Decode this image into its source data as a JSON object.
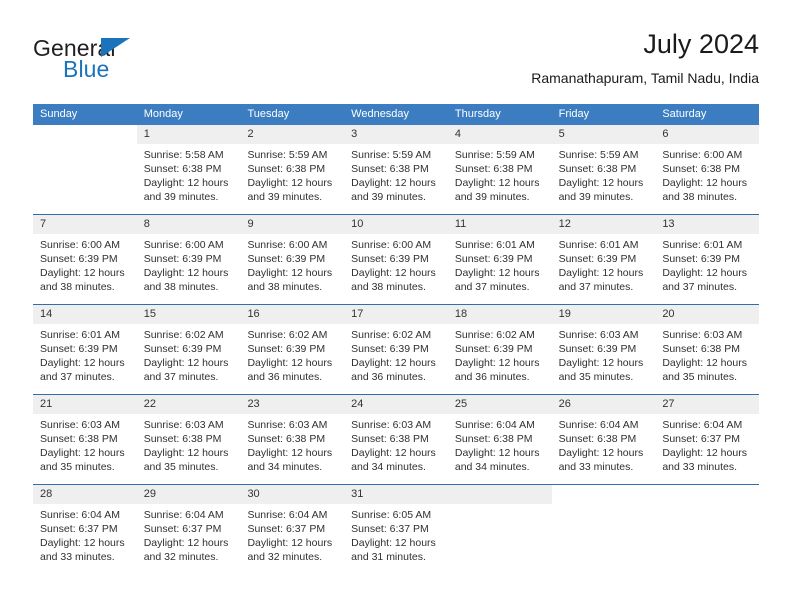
{
  "brand": {
    "name_top": "General",
    "name_bottom": "Blue",
    "triangle_color": "#1b74bb",
    "text_color": "#231f20"
  },
  "header": {
    "title": "July 2024",
    "location": "Ramanathapuram, Tamil Nadu, India"
  },
  "theme": {
    "header_bar_color": "#3b7dc0",
    "header_text_color": "#ffffff",
    "day_number_band": "#efefef",
    "week_rule_color": "#2f6fae"
  },
  "weekdays": [
    "Sunday",
    "Monday",
    "Tuesday",
    "Wednesday",
    "Thursday",
    "Friday",
    "Saturday"
  ],
  "weeks": [
    [
      {
        "day": "",
        "sunrise": "",
        "sunset": "",
        "daylight1": "",
        "daylight2": "",
        "blank": true
      },
      {
        "day": "1",
        "sunrise": "Sunrise: 5:58 AM",
        "sunset": "Sunset: 6:38 PM",
        "daylight1": "Daylight: 12 hours",
        "daylight2": "and 39 minutes."
      },
      {
        "day": "2",
        "sunrise": "Sunrise: 5:59 AM",
        "sunset": "Sunset: 6:38 PM",
        "daylight1": "Daylight: 12 hours",
        "daylight2": "and 39 minutes."
      },
      {
        "day": "3",
        "sunrise": "Sunrise: 5:59 AM",
        "sunset": "Sunset: 6:38 PM",
        "daylight1": "Daylight: 12 hours",
        "daylight2": "and 39 minutes."
      },
      {
        "day": "4",
        "sunrise": "Sunrise: 5:59 AM",
        "sunset": "Sunset: 6:38 PM",
        "daylight1": "Daylight: 12 hours",
        "daylight2": "and 39 minutes."
      },
      {
        "day": "5",
        "sunrise": "Sunrise: 5:59 AM",
        "sunset": "Sunset: 6:38 PM",
        "daylight1": "Daylight: 12 hours",
        "daylight2": "and 39 minutes."
      },
      {
        "day": "6",
        "sunrise": "Sunrise: 6:00 AM",
        "sunset": "Sunset: 6:38 PM",
        "daylight1": "Daylight: 12 hours",
        "daylight2": "and 38 minutes."
      }
    ],
    [
      {
        "day": "7",
        "sunrise": "Sunrise: 6:00 AM",
        "sunset": "Sunset: 6:39 PM",
        "daylight1": "Daylight: 12 hours",
        "daylight2": "and 38 minutes."
      },
      {
        "day": "8",
        "sunrise": "Sunrise: 6:00 AM",
        "sunset": "Sunset: 6:39 PM",
        "daylight1": "Daylight: 12 hours",
        "daylight2": "and 38 minutes."
      },
      {
        "day": "9",
        "sunrise": "Sunrise: 6:00 AM",
        "sunset": "Sunset: 6:39 PM",
        "daylight1": "Daylight: 12 hours",
        "daylight2": "and 38 minutes."
      },
      {
        "day": "10",
        "sunrise": "Sunrise: 6:00 AM",
        "sunset": "Sunset: 6:39 PM",
        "daylight1": "Daylight: 12 hours",
        "daylight2": "and 38 minutes."
      },
      {
        "day": "11",
        "sunrise": "Sunrise: 6:01 AM",
        "sunset": "Sunset: 6:39 PM",
        "daylight1": "Daylight: 12 hours",
        "daylight2": "and 37 minutes."
      },
      {
        "day": "12",
        "sunrise": "Sunrise: 6:01 AM",
        "sunset": "Sunset: 6:39 PM",
        "daylight1": "Daylight: 12 hours",
        "daylight2": "and 37 minutes."
      },
      {
        "day": "13",
        "sunrise": "Sunrise: 6:01 AM",
        "sunset": "Sunset: 6:39 PM",
        "daylight1": "Daylight: 12 hours",
        "daylight2": "and 37 minutes."
      }
    ],
    [
      {
        "day": "14",
        "sunrise": "Sunrise: 6:01 AM",
        "sunset": "Sunset: 6:39 PM",
        "daylight1": "Daylight: 12 hours",
        "daylight2": "and 37 minutes."
      },
      {
        "day": "15",
        "sunrise": "Sunrise: 6:02 AM",
        "sunset": "Sunset: 6:39 PM",
        "daylight1": "Daylight: 12 hours",
        "daylight2": "and 37 minutes."
      },
      {
        "day": "16",
        "sunrise": "Sunrise: 6:02 AM",
        "sunset": "Sunset: 6:39 PM",
        "daylight1": "Daylight: 12 hours",
        "daylight2": "and 36 minutes."
      },
      {
        "day": "17",
        "sunrise": "Sunrise: 6:02 AM",
        "sunset": "Sunset: 6:39 PM",
        "daylight1": "Daylight: 12 hours",
        "daylight2": "and 36 minutes."
      },
      {
        "day": "18",
        "sunrise": "Sunrise: 6:02 AM",
        "sunset": "Sunset: 6:39 PM",
        "daylight1": "Daylight: 12 hours",
        "daylight2": "and 36 minutes."
      },
      {
        "day": "19",
        "sunrise": "Sunrise: 6:03 AM",
        "sunset": "Sunset: 6:39 PM",
        "daylight1": "Daylight: 12 hours",
        "daylight2": "and 35 minutes."
      },
      {
        "day": "20",
        "sunrise": "Sunrise: 6:03 AM",
        "sunset": "Sunset: 6:38 PM",
        "daylight1": "Daylight: 12 hours",
        "daylight2": "and 35 minutes."
      }
    ],
    [
      {
        "day": "21",
        "sunrise": "Sunrise: 6:03 AM",
        "sunset": "Sunset: 6:38 PM",
        "daylight1": "Daylight: 12 hours",
        "daylight2": "and 35 minutes."
      },
      {
        "day": "22",
        "sunrise": "Sunrise: 6:03 AM",
        "sunset": "Sunset: 6:38 PM",
        "daylight1": "Daylight: 12 hours",
        "daylight2": "and 35 minutes."
      },
      {
        "day": "23",
        "sunrise": "Sunrise: 6:03 AM",
        "sunset": "Sunset: 6:38 PM",
        "daylight1": "Daylight: 12 hours",
        "daylight2": "and 34 minutes."
      },
      {
        "day": "24",
        "sunrise": "Sunrise: 6:03 AM",
        "sunset": "Sunset: 6:38 PM",
        "daylight1": "Daylight: 12 hours",
        "daylight2": "and 34 minutes."
      },
      {
        "day": "25",
        "sunrise": "Sunrise: 6:04 AM",
        "sunset": "Sunset: 6:38 PM",
        "daylight1": "Daylight: 12 hours",
        "daylight2": "and 34 minutes."
      },
      {
        "day": "26",
        "sunrise": "Sunrise: 6:04 AM",
        "sunset": "Sunset: 6:38 PM",
        "daylight1": "Daylight: 12 hours",
        "daylight2": "and 33 minutes."
      },
      {
        "day": "27",
        "sunrise": "Sunrise: 6:04 AM",
        "sunset": "Sunset: 6:37 PM",
        "daylight1": "Daylight: 12 hours",
        "daylight2": "and 33 minutes."
      }
    ],
    [
      {
        "day": "28",
        "sunrise": "Sunrise: 6:04 AM",
        "sunset": "Sunset: 6:37 PM",
        "daylight1": "Daylight: 12 hours",
        "daylight2": "and 33 minutes."
      },
      {
        "day": "29",
        "sunrise": "Sunrise: 6:04 AM",
        "sunset": "Sunset: 6:37 PM",
        "daylight1": "Daylight: 12 hours",
        "daylight2": "and 32 minutes."
      },
      {
        "day": "30",
        "sunrise": "Sunrise: 6:04 AM",
        "sunset": "Sunset: 6:37 PM",
        "daylight1": "Daylight: 12 hours",
        "daylight2": "and 32 minutes."
      },
      {
        "day": "31",
        "sunrise": "Sunrise: 6:05 AM",
        "sunset": "Sunset: 6:37 PM",
        "daylight1": "Daylight: 12 hours",
        "daylight2": "and 31 minutes."
      },
      {
        "day": "",
        "sunrise": "",
        "sunset": "",
        "daylight1": "",
        "daylight2": "",
        "empty": true
      },
      {
        "day": "",
        "sunrise": "",
        "sunset": "",
        "daylight1": "",
        "daylight2": "",
        "blank": true
      },
      {
        "day": "",
        "sunrise": "",
        "sunset": "",
        "daylight1": "",
        "daylight2": "",
        "blank": true
      }
    ]
  ]
}
